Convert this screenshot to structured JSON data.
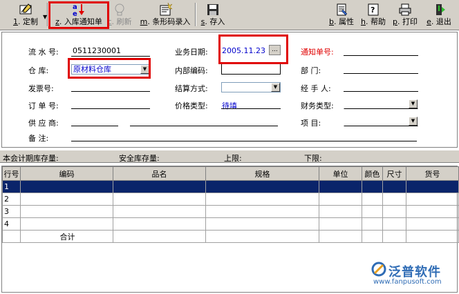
{
  "toolbar": {
    "buttons": [
      {
        "key": "1",
        "label": ". 定制"
      },
      {
        "key": "z",
        "label": ". 入库通知单"
      },
      {
        "key": "c",
        "label": ". 刷新"
      },
      {
        "key": "m",
        "label": ". 条形码录入"
      },
      {
        "key": "s",
        "label": ". 存入"
      },
      {
        "key": "b",
        "label": ". 属性"
      },
      {
        "key": "h",
        "label": ". 帮助"
      },
      {
        "key": "p",
        "label": ". 打印"
      },
      {
        "key": "e",
        "label": ". 退出"
      }
    ]
  },
  "form": {
    "serial_label": "流 水 号:",
    "serial_value": "0511230001",
    "warehouse_label": "仓  库:",
    "warehouse_value": "原材料仓库",
    "invoice_label": "发票号:",
    "order_label": "订 单 号:",
    "supplier_label": "供 应 商:",
    "remark_label": "备  注:",
    "bizdate_label": "业务日期:",
    "bizdate_value": "2005.11.23",
    "ellipsis_label": "...",
    "internal_code_label": "内部编码:",
    "settle_label": "结算方式:",
    "price_type_label": "价格类型:",
    "price_type_value": "待填",
    "notice_no_label": "通知单号:",
    "dept_label": "部  门:",
    "handler_label": "经 手 人:",
    "finance_type_label": "财务类型:",
    "project_label": "项  目:"
  },
  "stockbar": {
    "current_stock": "本会计期库存量:",
    "safe_stock": "安全库存量:",
    "upper": "上限:",
    "lower": "下限:"
  },
  "grid": {
    "columns": [
      "行号",
      "编码",
      "品名",
      "规格",
      "单位",
      "颜色",
      "尺寸",
      "货号"
    ],
    "rows": [
      "1",
      "2",
      "3",
      "4"
    ],
    "total_label": "合计"
  },
  "logo": {
    "brand": "泛普软件",
    "url": "www.fanpusoft.com"
  },
  "colors": {
    "toolbar_bg": "#d4d0c8",
    "selected_row": "#0a246a",
    "highlight_box": "#e00000",
    "link_blue": "#0000cc",
    "notice_red": "#e00000"
  }
}
